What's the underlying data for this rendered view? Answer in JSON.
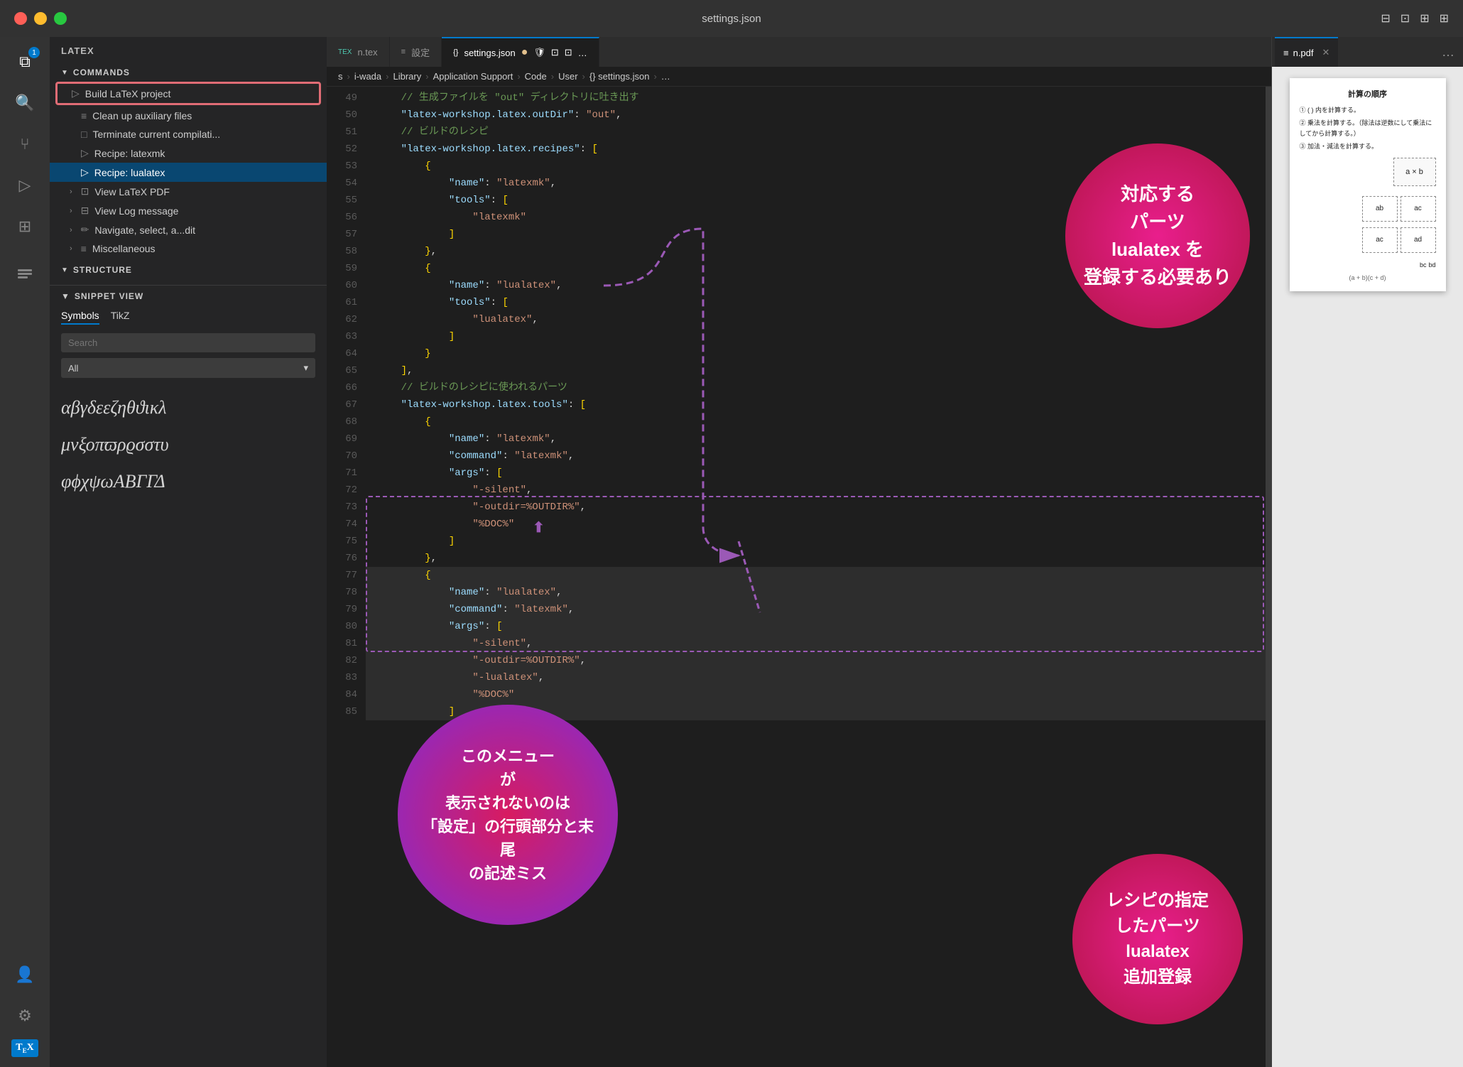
{
  "titlebar": {
    "title": "settings.json",
    "icons": [
      "⊟",
      "⊡",
      "⊞"
    ]
  },
  "tabs": [
    {
      "label": "n.tex",
      "icon": "TEX",
      "active": false
    },
    {
      "label": "設定",
      "icon": "≡",
      "active": false
    },
    {
      "label": "settings.json",
      "icon": "{}",
      "active": true,
      "dot": true
    },
    {
      "label": "n.pdf",
      "icon": "≡",
      "active": false,
      "closeable": true
    }
  ],
  "breadcrumb": {
    "parts": [
      "s",
      "i-wada",
      "Library",
      "Application Support",
      "Code",
      "User",
      "{} settings.json",
      "…"
    ]
  },
  "sidebar": {
    "header": "LATEX",
    "commands_label": "COMMANDS",
    "items": [
      {
        "label": "Build LaTeX project",
        "icon": "▷",
        "highlighted": true,
        "level": 1
      },
      {
        "label": "Clean up auxiliary files",
        "icon": "≡",
        "level": 2
      },
      {
        "label": "Terminate current compilati...",
        "icon": "□",
        "level": 2
      },
      {
        "label": "Recipe: latexmk",
        "icon": "▷",
        "level": 2
      },
      {
        "label": "Recipe: lualatex",
        "icon": "▷",
        "level": 2,
        "active": true
      },
      {
        "label": "View LaTeX PDF",
        "icon": "⊞",
        "level": 1,
        "expandable": true
      },
      {
        "label": "View Log message",
        "icon": "⊞",
        "level": 1,
        "expandable": true
      },
      {
        "label": "Navigate, select, a...dit",
        "icon": "✏",
        "level": 1,
        "expandable": true
      },
      {
        "label": "Miscellaneous",
        "icon": "≡",
        "level": 1,
        "expandable": true
      }
    ],
    "structure_label": "STRUCTURE",
    "snippet_view_label": "SNIPPET VIEW",
    "snippet_tabs": [
      "Symbols",
      "TikZ"
    ],
    "snippet_search_placeholder": "Search",
    "snippet_dropdown": "All",
    "symbols": "αβγδεεζηθϑικλ\nμνξοπϖρϱσστυ\nφϕχψωΑΒΓΓΔ"
  },
  "code": {
    "lines": [
      {
        "num": 49,
        "content": "    // 生成ファイルを \"out\" ディレクトリに吐き出す"
      },
      {
        "num": 50,
        "content": "    \"latex-workshop.latex.outDir\": \"out\","
      },
      {
        "num": 51,
        "content": "    // ビルドのレシピ"
      },
      {
        "num": 52,
        "content": "    \"latex-workshop.latex.recipes\": ["
      },
      {
        "num": 53,
        "content": "        {"
      },
      {
        "num": 54,
        "content": "            \"name\": \"latexmk\","
      },
      {
        "num": 55,
        "content": "            \"tools\": ["
      },
      {
        "num": 56,
        "content": "                \"latexmk\""
      },
      {
        "num": 57,
        "content": "            ]"
      },
      {
        "num": 58,
        "content": "        },"
      },
      {
        "num": 59,
        "content": "        {"
      },
      {
        "num": 60,
        "content": "            \"name\": \"lualatex\","
      },
      {
        "num": 61,
        "content": "            \"tools\": ["
      },
      {
        "num": 62,
        "content": "                \"lualatex\","
      },
      {
        "num": 63,
        "content": "            ]"
      },
      {
        "num": 64,
        "content": "        }"
      },
      {
        "num": 65,
        "content": "    ],"
      },
      {
        "num": 66,
        "content": "    // ビルドのレシピに使われるパーツ"
      },
      {
        "num": 67,
        "content": "    \"latex-workshop.latex.tools\": ["
      },
      {
        "num": 68,
        "content": "        {"
      },
      {
        "num": 69,
        "content": "            \"name\": \"latexmk\","
      },
      {
        "num": 70,
        "content": "            \"command\": \"latexmk\","
      },
      {
        "num": 71,
        "content": "            \"args\": ["
      },
      {
        "num": 72,
        "content": "                \"-silent\","
      },
      {
        "num": 73,
        "content": "                \"-outdir=%OUTDIR%\","
      },
      {
        "num": 74,
        "content": "                \"%DOC%\""
      },
      {
        "num": 75,
        "content": "            ]"
      },
      {
        "num": 76,
        "content": "        },"
      },
      {
        "num": 77,
        "content": "        {"
      },
      {
        "num": 78,
        "content": "            \"name\": \"lualatex\","
      },
      {
        "num": 79,
        "content": "            \"command\": \"latexmk\","
      },
      {
        "num": 80,
        "content": "            \"args\": ["
      },
      {
        "num": 81,
        "content": "                \"-silent\","
      },
      {
        "num": 82,
        "content": "                \"-outdir=%OUTDIR%\","
      },
      {
        "num": 83,
        "content": "                \"-lualatex\","
      },
      {
        "num": 84,
        "content": "                \"%DOC%\""
      },
      {
        "num": 85,
        "content": "            ]"
      }
    ]
  },
  "bubbles": [
    {
      "id": "bubble1",
      "text": "対応する\nパーツ\nlualatex を\n登録する必要あり",
      "color": "pink"
    },
    {
      "id": "bubble2",
      "text": "このメニュー\nが\n表示されないのは\n「設定」の行頭部分と末尾\nの記述ミス",
      "color": "magenta"
    },
    {
      "id": "bubble3",
      "text": "レシピの指定\nしたパーツ\nlualatex\n追加登録",
      "color": "pink"
    }
  ],
  "pdf": {
    "title": "計算の順序",
    "list_items": [
      "① ( ) 内を計算する。",
      "② 乗法を計算する。（除法は逆数にして乗法にしてから計算する。）",
      "③ 加法・減法を計算する。"
    ],
    "formula1": "a × b",
    "formula2": "ab",
    "formula3": "ac",
    "formula4": "ac",
    "formula5": "ad",
    "formula6": "bc",
    "formula7": "bd"
  }
}
